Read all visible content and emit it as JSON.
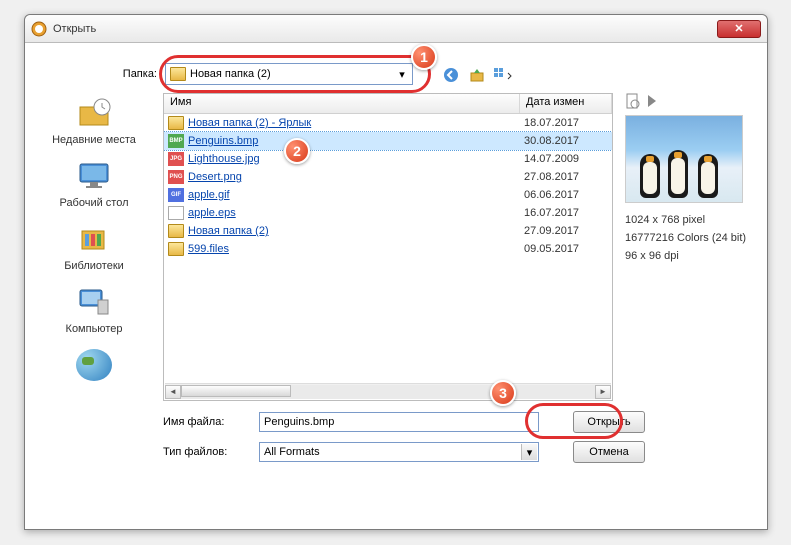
{
  "window": {
    "title": "Открыть"
  },
  "folder": {
    "label": "Папка:",
    "value": "Новая папка (2)"
  },
  "columns": {
    "name": "Имя",
    "date": "Дата измен"
  },
  "files": [
    {
      "icon": "fold",
      "name": "Новая папка (2) - Ярлык",
      "date": "18.07.2017",
      "sel": false
    },
    {
      "icon": "bmp",
      "name": "Penguins.bmp",
      "date": "30.08.2017",
      "sel": true
    },
    {
      "icon": "jpg",
      "name": "Lighthouse.jpg",
      "date": "14.07.2009",
      "sel": false
    },
    {
      "icon": "png",
      "name": "Desert.png",
      "date": "27.08.2017",
      "sel": false
    },
    {
      "icon": "gif",
      "name": "apple.gif",
      "date": "06.06.2017",
      "sel": false
    },
    {
      "icon": "eps",
      "name": "apple.eps",
      "date": "16.07.2017",
      "sel": false
    },
    {
      "icon": "fold",
      "name": "Новая папка (2)",
      "date": "27.09.2017",
      "sel": false
    },
    {
      "icon": "fold",
      "name": "599.files",
      "date": "09.05.2017",
      "sel": false
    }
  ],
  "sidebar": [
    {
      "label": "Недавние места"
    },
    {
      "label": "Рабочий стол"
    },
    {
      "label": "Библиотеки"
    },
    {
      "label": "Компьютер"
    },
    {
      "label": ""
    }
  ],
  "preview": {
    "dimensions": "1024 x 768 pixel",
    "colors": "16777216 Colors (24 bit)",
    "dpi": "96 x 96 dpi"
  },
  "filename": {
    "label": "Имя файла:",
    "value": "Penguins.bmp"
  },
  "filetype": {
    "label": "Тип файлов:",
    "value": "All Formats"
  },
  "buttons": {
    "open": "Открыть",
    "cancel": "Отмена"
  },
  "callouts": {
    "c1": "1",
    "c2": "2",
    "c3": "3"
  }
}
